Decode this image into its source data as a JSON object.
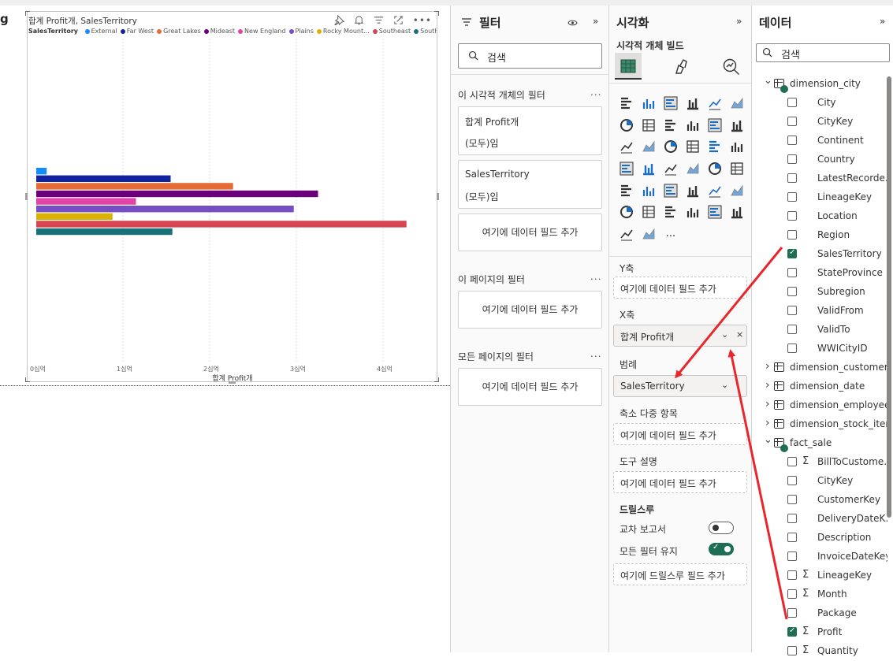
{
  "canvas": {
    "edge_text": "g",
    "visual": {
      "title": "합계 Profit개, SalesTerritory",
      "legend_title": "SalesTerritory",
      "legend": [
        {
          "name": "External",
          "color": "#118dff"
        },
        {
          "name": "Far West",
          "color": "#12239e"
        },
        {
          "name": "Great Lakes",
          "color": "#e66c37"
        },
        {
          "name": "Mideast",
          "color": "#6b007b"
        },
        {
          "name": "New England",
          "color": "#e044a7"
        },
        {
          "name": "Plains",
          "color": "#744ec2"
        },
        {
          "name": "Rocky Mount...",
          "color": "#d9b300"
        },
        {
          "name": "Southeast",
          "color": "#d64550"
        },
        {
          "name": "Southwest",
          "color": "#197278"
        }
      ],
      "icons": [
        "pin-icon",
        "bell-icon",
        "filter-icon",
        "focus-mode-icon",
        "more-options-icon"
      ]
    }
  },
  "chart_data": {
    "type": "bar",
    "orientation": "horizontal",
    "series": [
      {
        "name": "External",
        "value": 0.12
      },
      {
        "name": "Far West",
        "value": 1.55
      },
      {
        "name": "Great Lakes",
        "value": 2.27
      },
      {
        "name": "Mideast",
        "value": 3.25
      },
      {
        "name": "New England",
        "value": 1.15
      },
      {
        "name": "Plains",
        "value": 2.97
      },
      {
        "name": "Rocky Mount...",
        "value": 0.88
      },
      {
        "name": "Southeast",
        "value": 4.27
      },
      {
        "name": "Southwest",
        "value": 1.57
      }
    ],
    "xticks": [
      "0십억",
      "1십억",
      "2십억",
      "3십억",
      "4십억"
    ],
    "xlim": [
      0,
      4.5
    ],
    "xlabel": "합계 Profit개",
    "ylabel": "",
    "grid": true
  },
  "filters": {
    "title": "필터",
    "search_placeholder": "검색",
    "visual_section": "이 시각적 개체의 필터",
    "cards": [
      {
        "name": "합계 Profit개",
        "state": "(모두)임"
      },
      {
        "name": "SalesTerritory",
        "state": "(모두)임"
      }
    ],
    "add_field": "여기에 데이터 필드 추가",
    "page_section": "이 페이지의 필터",
    "all_section": "모든 페이지의 필터",
    "more": "..."
  },
  "viz": {
    "title": "시각화",
    "subtitle": "시각적 개체 빌드",
    "more_visuals": "...",
    "y_label": "Y축",
    "y_placeholder": "여기에 데이터 필드 추가",
    "x_label": "X축",
    "x_value": "합계 Profit개",
    "legend_label": "범례",
    "legend_value": "SalesTerritory",
    "small_multiples_label": "축소 다중 항목",
    "small_multiples_placeholder": "여기에 데이터 필드 추가",
    "tooltip_label": "도구 설명",
    "tooltip_placeholder": "여기에 데이터 필드 추가",
    "drill_label": "드릴스루",
    "cross_report_label": "교차 보고서",
    "cross_report_on": false,
    "keep_filters_label": "모든 필터 유지",
    "keep_filters_on": true,
    "drill_placeholder": "여기에 드릴스루 필드 추가",
    "accent": "#1e6e56"
  },
  "data": {
    "title": "데이터",
    "search_placeholder": "검색",
    "tree": [
      {
        "type": "table",
        "label": "dimension_city",
        "expanded": true,
        "checked": true
      },
      {
        "type": "field",
        "label": "City",
        "checked": false,
        "sigma": false
      },
      {
        "type": "field",
        "label": "CityKey",
        "checked": false,
        "sigma": false
      },
      {
        "type": "field",
        "label": "Continent",
        "checked": false,
        "sigma": false
      },
      {
        "type": "field",
        "label": "Country",
        "checked": false,
        "sigma": false
      },
      {
        "type": "field",
        "label": "LatestRecorde...",
        "checked": false,
        "sigma": false
      },
      {
        "type": "field",
        "label": "LineageKey",
        "checked": false,
        "sigma": false
      },
      {
        "type": "field",
        "label": "Location",
        "checked": false,
        "sigma": false
      },
      {
        "type": "field",
        "label": "Region",
        "checked": false,
        "sigma": false
      },
      {
        "type": "field",
        "label": "SalesTerritory",
        "checked": true,
        "sigma": false
      },
      {
        "type": "field",
        "label": "StateProvince",
        "checked": false,
        "sigma": false
      },
      {
        "type": "field",
        "label": "Subregion",
        "checked": false,
        "sigma": false
      },
      {
        "type": "field",
        "label": "ValidFrom",
        "checked": false,
        "sigma": false
      },
      {
        "type": "field",
        "label": "ValidTo",
        "checked": false,
        "sigma": false
      },
      {
        "type": "field",
        "label": "WWICityID",
        "checked": false,
        "sigma": false
      },
      {
        "type": "table",
        "label": "dimension_customer",
        "expanded": false,
        "checked": false
      },
      {
        "type": "table",
        "label": "dimension_date",
        "expanded": false,
        "checked": false
      },
      {
        "type": "table",
        "label": "dimension_employee",
        "expanded": false,
        "checked": false
      },
      {
        "type": "table",
        "label": "dimension_stock_item",
        "expanded": false,
        "checked": false
      },
      {
        "type": "table",
        "label": "fact_sale",
        "expanded": true,
        "checked": true
      },
      {
        "type": "field",
        "label": "BillToCustome...",
        "checked": false,
        "sigma": true
      },
      {
        "type": "field",
        "label": "CityKey",
        "checked": false,
        "sigma": false
      },
      {
        "type": "field",
        "label": "CustomerKey",
        "checked": false,
        "sigma": false
      },
      {
        "type": "field",
        "label": "DeliveryDateK...",
        "checked": false,
        "sigma": false
      },
      {
        "type": "field",
        "label": "Description",
        "checked": false,
        "sigma": false
      },
      {
        "type": "field",
        "label": "InvoiceDateKey",
        "checked": false,
        "sigma": false
      },
      {
        "type": "field",
        "label": "LineageKey",
        "checked": false,
        "sigma": true
      },
      {
        "type": "field",
        "label": "Month",
        "checked": false,
        "sigma": true
      },
      {
        "type": "field",
        "label": "Package",
        "checked": false,
        "sigma": false
      },
      {
        "type": "field",
        "label": "Profit",
        "checked": true,
        "sigma": true
      },
      {
        "type": "field",
        "label": "Quantity",
        "checked": false,
        "sigma": true
      }
    ]
  },
  "annotation_color": "#e8262b"
}
